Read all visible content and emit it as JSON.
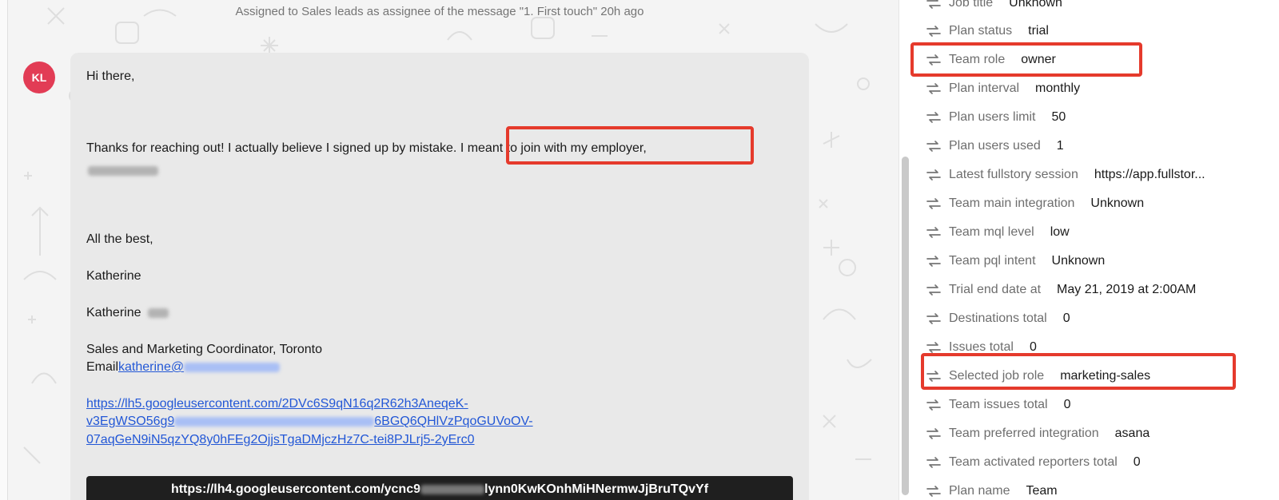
{
  "conversation": {
    "activity_note": "Assigned to Sales leads as assignee of the message \"1. First touch\" 20h ago",
    "avatar_initials": "KL",
    "message": {
      "greeting": "Hi there,",
      "line1": "Thanks for reaching out! I actually believe I signed up by mistake.",
      "line1_highlight": "I meant to join with my employer,",
      "signoff": "All the best,",
      "name1": "Katherine",
      "name2": "Katherine",
      "title_line": "Sales and Marketing Coordinator, Toronto",
      "email_label": "Email",
      "email_link": "katherine@",
      "url1_line1": "https://lh5.googleusercontent.com/2DVc6S9qN16q2R62h3AneqeK-",
      "url1_line2a": "v3EgWSO56g9",
      "url1_line2b": "6BGQ6QHlVzPqoGUVoOV-",
      "url1_line3": "07aqGeN9iN5qzYQ8y0hFEg2OjjsTgaDMjczHz7C-tei8PJLrj5-2yErc0",
      "url2_a": "https://lh4.googleusercontent.com/ycnc9",
      "url2_b": "lynn0KwKOnhMiHNermwJjBruTQvYf"
    }
  },
  "attributes": [
    {
      "label": "Job title",
      "value": "Unknown"
    },
    {
      "label": "Plan status",
      "value": "trial"
    },
    {
      "label": "Team role",
      "value": "owner"
    },
    {
      "label": "Plan interval",
      "value": "monthly"
    },
    {
      "label": "Plan users limit",
      "value": "50"
    },
    {
      "label": "Plan users used",
      "value": "1"
    },
    {
      "label": "Latest fullstory session",
      "value": "https://app.fullstor..."
    },
    {
      "label": "Team main integration",
      "value": "Unknown"
    },
    {
      "label": "Team mql level",
      "value": "low"
    },
    {
      "label": "Team pql intent",
      "value": "Unknown"
    },
    {
      "label": "Trial end date at",
      "value": "May 21, 2019 at 2:00AM"
    },
    {
      "label": "Destinations total",
      "value": "0"
    },
    {
      "label": "Issues total",
      "value": "0"
    },
    {
      "label": "Selected job role",
      "value": "marketing-sales"
    },
    {
      "label": "Team issues total",
      "value": "0"
    },
    {
      "label": "Team preferred integration",
      "value": "asana"
    },
    {
      "label": "Team activated reporters total",
      "value": "0"
    },
    {
      "label": "Plan name",
      "value": "Team"
    }
  ],
  "icons": {
    "attribute_icon": "arrows-exchange-icon"
  },
  "colors": {
    "highlight": "#e53a2c",
    "avatar": "#e23c55",
    "link": "#2257d6"
  }
}
